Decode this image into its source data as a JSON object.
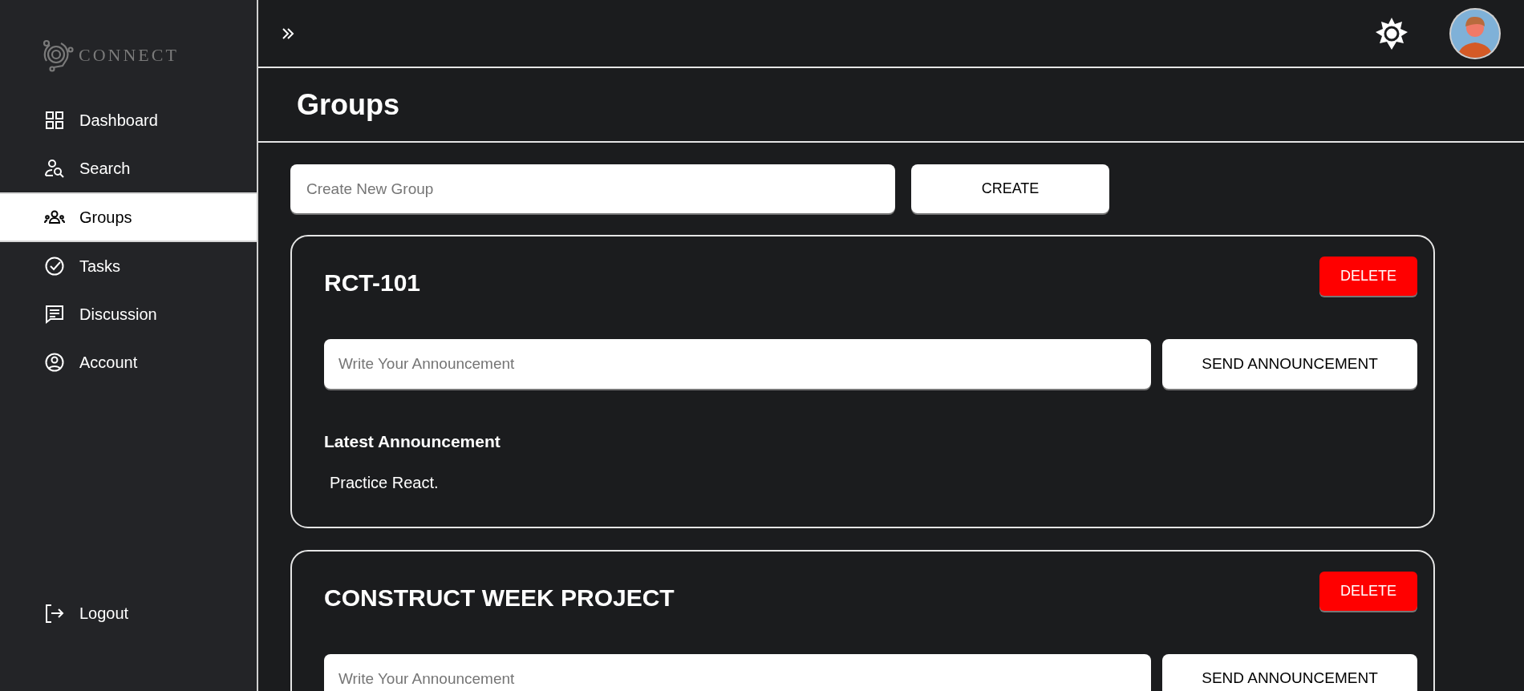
{
  "brand": "CONNECT",
  "sidebar": {
    "items": [
      {
        "label": "Dashboard",
        "selected": false
      },
      {
        "label": "Search",
        "selected": false
      },
      {
        "label": "Groups",
        "selected": true
      },
      {
        "label": "Tasks",
        "selected": false
      },
      {
        "label": "Discussion",
        "selected": false
      },
      {
        "label": "Account",
        "selected": false
      }
    ],
    "logout": "Logout"
  },
  "page_title": "Groups",
  "create_field": {
    "placeholder": "Create New Group"
  },
  "create_button": "CREATE",
  "groups": [
    {
      "name": "RCT-101",
      "delete_button": "DELETE",
      "announcement_field": {
        "placeholder": "Write Your Announcement"
      },
      "send_button": "SEND ANNOUNCEMENT",
      "latest_heading": "Latest Announcement",
      "latest_text": "Practice React."
    },
    {
      "name": "CONSTRUCT WEEK PROJECT",
      "delete_button": "DELETE",
      "announcement_field": {
        "placeholder": "Write Your Announcement"
      },
      "send_button": "SEND ANNOUNCEMENT"
    }
  ]
}
